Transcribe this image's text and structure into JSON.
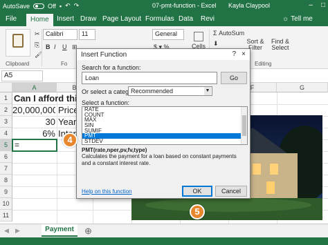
{
  "titlebar": {
    "autosave_label": "AutoSave",
    "autosave_state": "Off",
    "title": "07-pmt-function - Excel",
    "user": "Kayla Claypool"
  },
  "ribbon_tabs": [
    {
      "label": "File"
    },
    {
      "label": "Home"
    },
    {
      "label": "Insert"
    },
    {
      "label": "Draw"
    },
    {
      "label": "Page Layout"
    },
    {
      "label": "Formulas"
    },
    {
      "label": "Data"
    },
    {
      "label": "Revi"
    }
  ],
  "tell_me": "Tell me",
  "ribbon": {
    "font_name": "Calibri",
    "font_size": "11",
    "number_format": "General",
    "autosum": "AutoSum",
    "sort_filter": "Sort & Filter",
    "find_select": "Find & Select",
    "cells": "Cells",
    "clipboard_label": "Clipboard",
    "font_label": "Fo",
    "editing_label": "Editing"
  },
  "formula_bar": {
    "name_box": "A5"
  },
  "columns": [
    "A",
    "B",
    "C",
    "D",
    "E",
    "F",
    "G"
  ],
  "rows": [
    "1",
    "2",
    "3",
    "4",
    "5",
    "6",
    "7",
    "8",
    "9",
    "10",
    "11"
  ],
  "cells": {
    "a1": "Can I afford this hou",
    "a2": "20,000,000",
    "b2": "Price",
    "a3": "30",
    "b3": "Years",
    "a4": "6%",
    "b4": "Inter",
    "a5": "="
  },
  "sheet_tab": "Payment",
  "dialog": {
    "title": "Insert Function",
    "help": "?",
    "close": "×",
    "search_label": "Search for a function:",
    "search_value": "Loan",
    "go_button": "Go",
    "category_label": "Or select a category:",
    "category_value": "Recommended",
    "select_label": "Select a function:",
    "functions": [
      "RATE",
      "COUNT",
      "MAX",
      "SIN",
      "SUMIF",
      "PMT",
      "STDEV"
    ],
    "selected_function": "PMT",
    "syntax": "PMT(rate,nper,pv,fv,type)",
    "description": "Calculates the payment for a loan based on constant payments and a constant interest rate.",
    "help_link": "Help on this function",
    "ok_button": "OK",
    "cancel_button": "Cancel"
  },
  "callouts": {
    "step4": "4",
    "step5": "5"
  },
  "colors": {
    "excel_green": "#217346",
    "callout_orange": "#e8862d",
    "selection_blue": "#0078d7"
  }
}
